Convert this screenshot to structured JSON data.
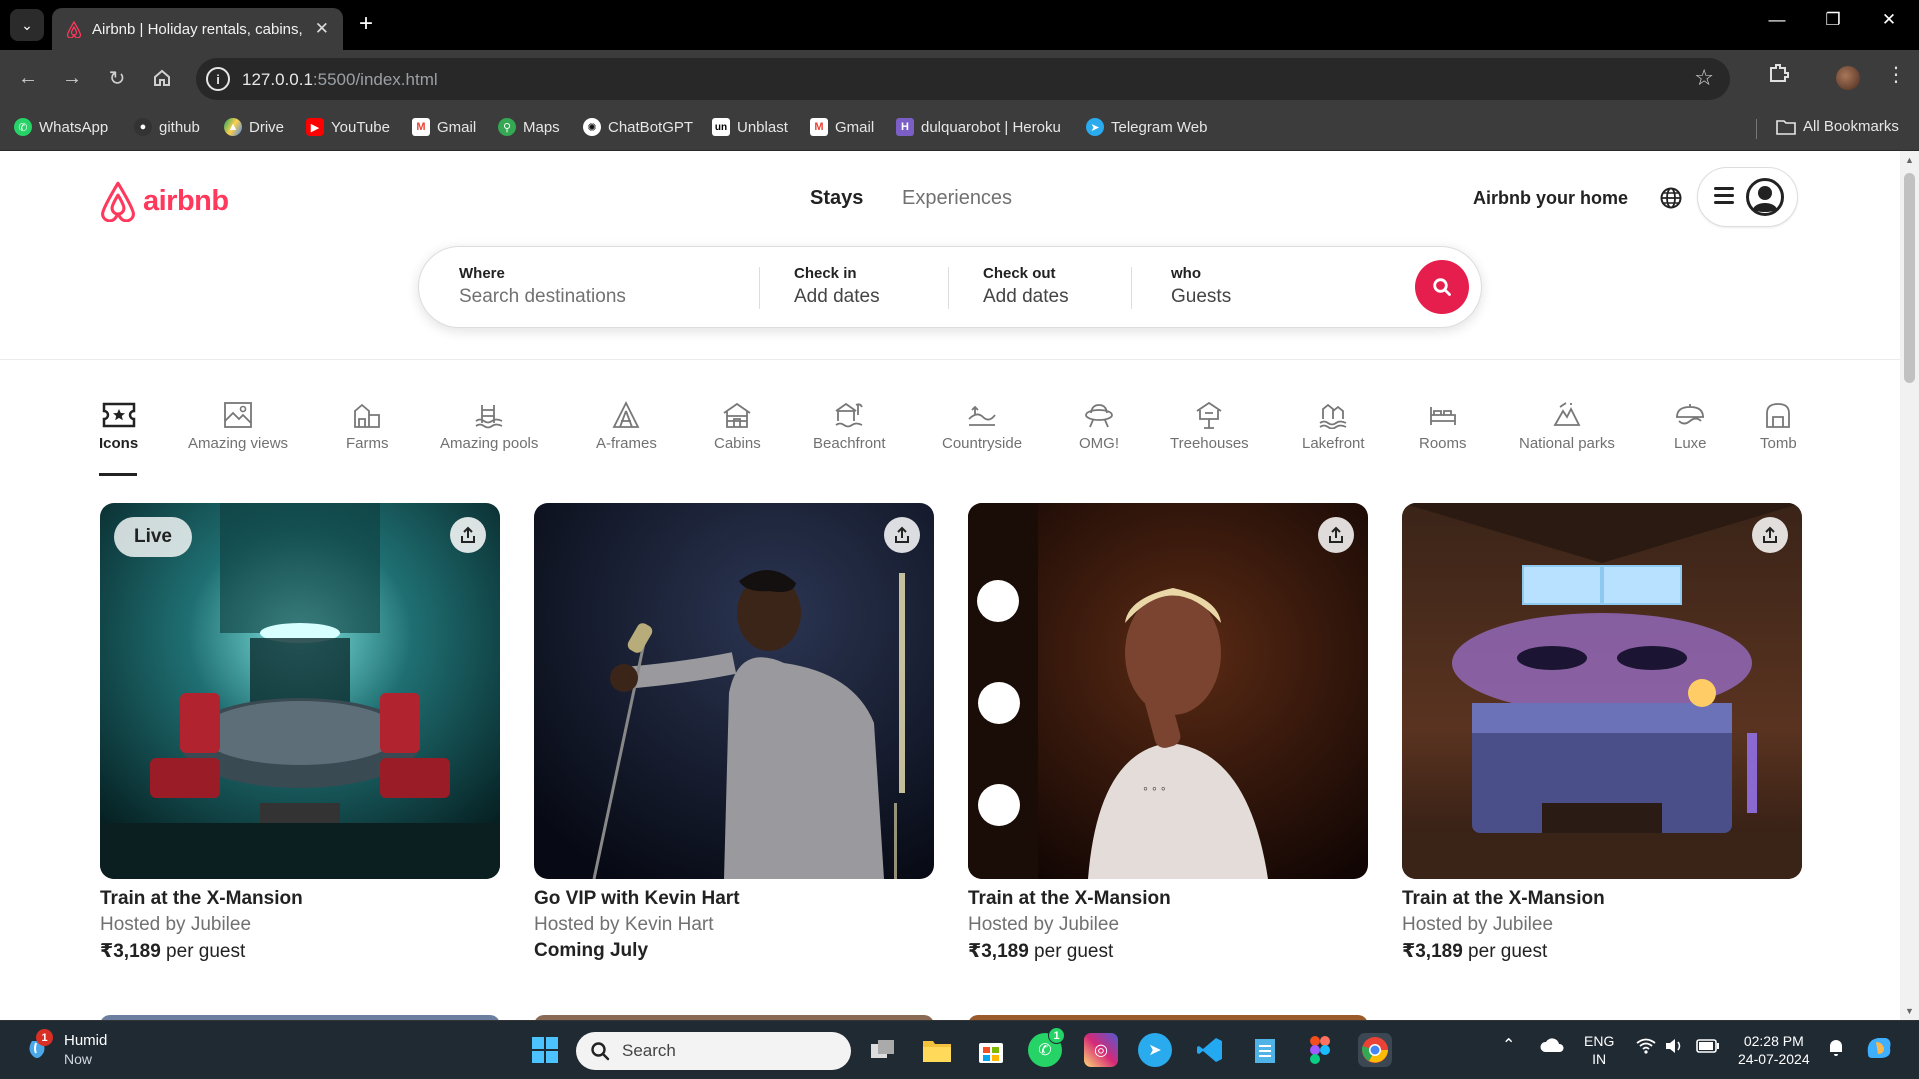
{
  "browser": {
    "tab_title": "Airbnb | Holiday rentals, cabins,",
    "url_host": "127.0.0.1",
    "url_path": ":5500/index.html",
    "bookmarks": [
      {
        "label": "WhatsApp",
        "icon": "whatsapp-icon",
        "color": "#25D366"
      },
      {
        "label": "github",
        "icon": "github-icon",
        "color": "#333333"
      },
      {
        "label": "Drive",
        "icon": "drive-icon",
        "color": "#1FA463"
      },
      {
        "label": "YouTube",
        "icon": "youtube-icon",
        "color": "#FF0000"
      },
      {
        "label": "Gmail",
        "icon": "gmail-icon",
        "color": "#EA4335"
      },
      {
        "label": "Maps",
        "icon": "maps-icon",
        "color": "#34A853"
      },
      {
        "label": "ChatBotGPT",
        "icon": "chatgpt-icon",
        "color": "#ffffff"
      },
      {
        "label": "Unblast",
        "icon": "unblast-icon",
        "color": "#000000"
      },
      {
        "label": "Gmail",
        "icon": "gmail-icon",
        "color": "#EA4335"
      },
      {
        "label": "dulquarobot | Heroku",
        "icon": "heroku-icon",
        "color": "#7B5FC7"
      },
      {
        "label": "Telegram Web",
        "icon": "telegram-icon",
        "color": "#2AABEE"
      }
    ],
    "all_bookmarks_label": "All Bookmarks"
  },
  "airbnb": {
    "logo_text": "airbnb",
    "nav": {
      "stays": "Stays",
      "experiences": "Experiences"
    },
    "host_link": "Airbnb your home",
    "search": {
      "where_label": "Where",
      "where_placeholder": "Search destinations",
      "checkin_label": "Check in",
      "checkin_value": "Add dates",
      "checkout_label": "Check out",
      "checkout_value": "Add dates",
      "who_label": "who",
      "who_value": "Guests"
    },
    "categories": [
      {
        "label": "Icons",
        "icon": "icons-category-icon",
        "active": true
      },
      {
        "label": "Amazing views",
        "icon": "amazing-views-icon"
      },
      {
        "label": "Farms",
        "icon": "farms-icon"
      },
      {
        "label": "Amazing pools",
        "icon": "pools-icon"
      },
      {
        "label": "A-frames",
        "icon": "a-frames-icon"
      },
      {
        "label": "Cabins",
        "icon": "cabins-icon"
      },
      {
        "label": "Beachfront",
        "icon": "beachfront-icon"
      },
      {
        "label": "Countryside",
        "icon": "countryside-icon"
      },
      {
        "label": "OMG!",
        "icon": "omg-icon"
      },
      {
        "label": "Treehouses",
        "icon": "treehouses-icon"
      },
      {
        "label": "Lakefront",
        "icon": "lakefront-icon"
      },
      {
        "label": "Rooms",
        "icon": "rooms-icon"
      },
      {
        "label": "National parks",
        "icon": "national-parks-icon"
      },
      {
        "label": "Luxe",
        "icon": "luxe-icon"
      },
      {
        "label": "Tomb",
        "icon": "tomb-icon"
      }
    ],
    "listings": [
      {
        "badge": "Live",
        "title": "Train at the X-Mansion",
        "host": "Hosted by Jubilee",
        "price": "₹3,189",
        "price_suffix": " per guest"
      },
      {
        "badge": "",
        "title": "Go VIP with Kevin Hart",
        "host": "Hosted by Kevin Hart",
        "price": "Coming July",
        "price_suffix": ""
      },
      {
        "badge": "",
        "title": "Train at the X-Mansion",
        "host": "Hosted by Jubilee",
        "price": "₹3,189",
        "price_suffix": " per guest"
      },
      {
        "badge": "",
        "title": "Train at the X-Mansion",
        "host": "Hosted by Jubilee",
        "price": "₹3,189",
        "price_suffix": " per guest"
      }
    ],
    "brand_color": "#FF385C"
  },
  "taskbar": {
    "weather_title": "Humid",
    "weather_sub": "Now",
    "weather_badge": "1",
    "search_placeholder": "Search",
    "whatsapp_badge": "1",
    "lang_top": "ENG",
    "lang_bottom": "IN",
    "time": "02:28 PM",
    "date": "24-07-2024"
  }
}
